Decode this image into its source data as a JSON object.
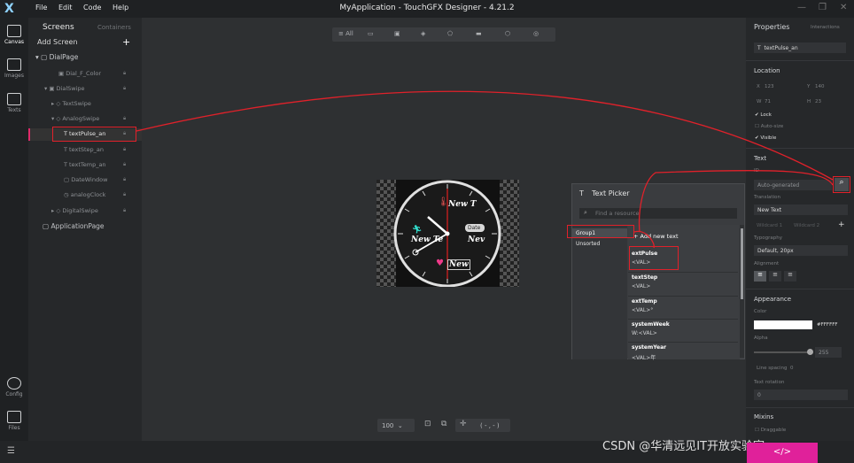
{
  "app": {
    "title": "MyApplication - TouchGFX Designer - 4.21.2",
    "logo": "X",
    "menu": [
      "File",
      "Edit",
      "Code",
      "Help"
    ]
  },
  "rail": {
    "items": [
      {
        "label": "Canvas",
        "icon": "canvas-icon"
      },
      {
        "label": "Images",
        "icon": "images-icon"
      },
      {
        "label": "Texts",
        "icon": "texts-icon"
      },
      {
        "label": "Config",
        "icon": "gear-icon"
      },
      {
        "label": "Files",
        "icon": "folder-icon"
      }
    ]
  },
  "screens": {
    "title": "Screens",
    "containers_tab": "Containers",
    "add_screen": "Add Screen",
    "tree": [
      {
        "label": "DialPage"
      },
      {
        "label": "Dial_F_Color"
      },
      {
        "label": "DialSwipe"
      },
      {
        "label": "TextSwipe"
      },
      {
        "label": "AnalogSwipe"
      },
      {
        "label": "textPulse_an"
      },
      {
        "label": "textStep_an"
      },
      {
        "label": "textTemp_an"
      },
      {
        "label": "DateWindow"
      },
      {
        "label": "analogClock"
      },
      {
        "label": "DigitalSwipe"
      },
      {
        "label": "ApplicationPage"
      }
    ]
  },
  "toolbar": {
    "all_label": "All"
  },
  "canvas": {
    "zoom": "100",
    "coords": "( - , - )",
    "display": {
      "text_top": "New T",
      "text_mid": "New Te",
      "text_right": "Nev",
      "text_bottom": "New",
      "date_badge": "Date"
    }
  },
  "picker": {
    "title": "Text Picker",
    "search_placeholder": "Find a resource",
    "groups": [
      "Group1",
      "Unsorted"
    ],
    "add_label": "Add new text",
    "items": [
      {
        "name": "extPulse",
        "value": "<VAL>"
      },
      {
        "name": "textStep",
        "value": "<VAL>"
      },
      {
        "name": "extTemp",
        "value": "<VAL>°"
      },
      {
        "name": "systemWeek",
        "value": "W:<VAL>"
      },
      {
        "name": "systemYear",
        "value": "<VAL>年"
      }
    ]
  },
  "properties": {
    "title": "Properties",
    "interactions_tab": "Interactions",
    "widget_name": "textPulse_an",
    "location_title": "Location",
    "x_label": "X",
    "x_value": "123",
    "y_label": "Y",
    "y_value": "140",
    "w_label": "W",
    "w_value": "71",
    "h_label": "H",
    "h_value": "23",
    "lock_label": "Lock",
    "autosize_label": "Auto-size",
    "visible_label": "Visible",
    "text_title": "Text",
    "id_label": "ID",
    "id_value": "Auto-generated",
    "translation_label": "Translation",
    "translation_value": "New Text",
    "wildcard1": "Wildcard 1",
    "wildcard2": "Wildcard 2",
    "typography_label": "Typography",
    "typography_value": "Default, 20px",
    "alignment_label": "Alignment",
    "appearance_title": "Appearance",
    "color_label": "Color",
    "color_value": "#FFFFFF",
    "alpha_label": "Alpha",
    "alpha_value": "255",
    "line_spacing_label": "Line spacing",
    "line_spacing_value": "0",
    "rotation_label": "Text rotation",
    "rotation_value": "0",
    "mixins_title": "Mixins",
    "draggable_label": "Draggable"
  },
  "code_button": "</>",
  "watermark": "CSDN @华清远见IT开放实验室",
  "colors": {
    "accent": "#e0219a",
    "highlight": "#e0212a"
  }
}
